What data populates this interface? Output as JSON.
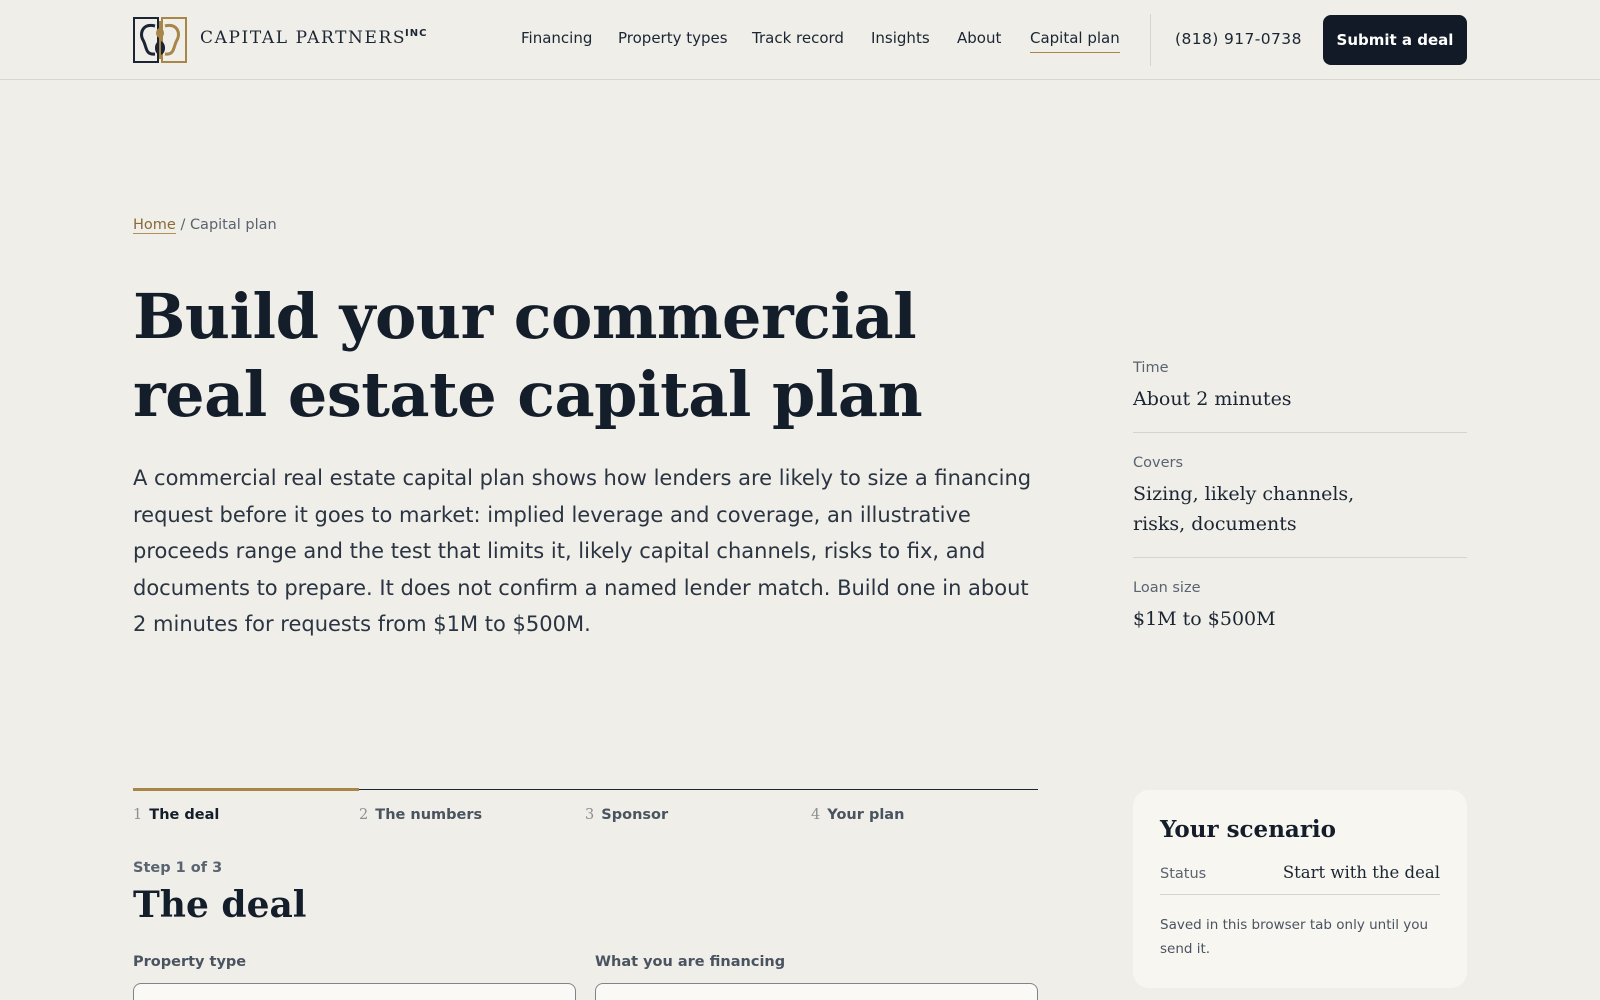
{
  "brand": {
    "name": "CAPITAL PARTNERS",
    "suffix": "INC"
  },
  "nav": {
    "items": [
      {
        "label": "Financing"
      },
      {
        "label": "Property types"
      },
      {
        "label": "Track record"
      },
      {
        "label": "Insights"
      },
      {
        "label": "About"
      },
      {
        "label": "Capital plan",
        "active": true
      }
    ],
    "phone": "(818) 917-0738",
    "cta_label": "Submit a deal"
  },
  "breadcrumb": {
    "home": "Home",
    "separator": "/",
    "current": "Capital plan"
  },
  "hero": {
    "title_line1": "Build your commercial",
    "title_line2": "real estate capital plan",
    "description": "A commercial real estate capital plan shows how lenders are likely to size a financing request before it goes to market: implied leverage and coverage, an illustrative proceeds range and the test that limits it, likely capital channels, risks to fix, and documents to prepare. It does not confirm a named lender match. Build one in about 2 minutes for requests from $1M to $500M."
  },
  "facts": [
    {
      "label": "Time",
      "value": "About 2 minutes"
    },
    {
      "label": "Covers",
      "value": "Sizing, likely channels, risks, documents"
    },
    {
      "label": "Loan size",
      "value": "$1M to $500M"
    }
  ],
  "steps": {
    "items": [
      {
        "num": "1",
        "label": "The deal"
      },
      {
        "num": "2",
        "label": "The numbers"
      },
      {
        "num": "3",
        "label": "Sponsor"
      },
      {
        "num": "4",
        "label": "Your plan"
      }
    ],
    "current": 1,
    "progress": 0.25
  },
  "form": {
    "step_count": "Step 1 of 3",
    "title": "The deal",
    "fields": [
      {
        "label": "Property type",
        "value": ""
      },
      {
        "label": "What you are financing",
        "value": ""
      }
    ]
  },
  "scenario": {
    "title": "Your scenario",
    "status_label": "Status",
    "status_value": "Start with the deal",
    "note": "Saved in this browser tab only until you send it."
  },
  "colors": {
    "accent": "#a88549",
    "ink": "#111a26",
    "background": "#efeee8",
    "card": "#f7f6f1"
  }
}
